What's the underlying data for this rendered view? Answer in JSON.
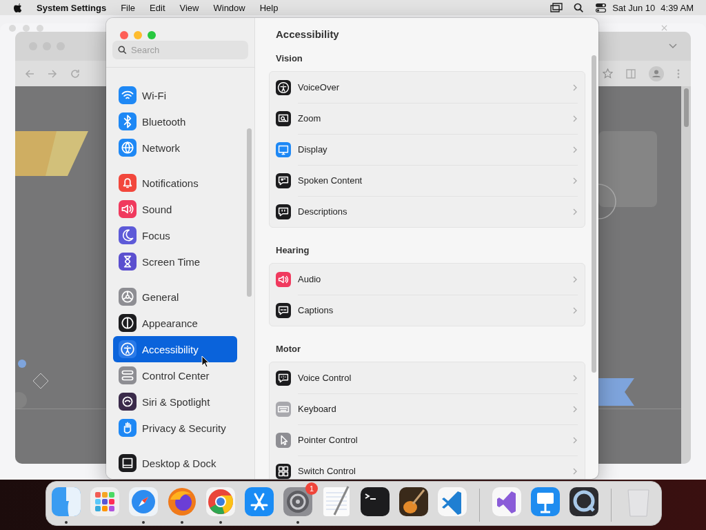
{
  "menu_bar": {
    "app_name": "System Settings",
    "menus": [
      "File",
      "Edit",
      "View",
      "Window",
      "Help"
    ],
    "date": "Sat Jun 10",
    "time": "4:39 AM"
  },
  "settings": {
    "title": "Accessibility",
    "search": {
      "placeholder": "Search"
    },
    "sidebar": [
      {
        "items": [
          {
            "label": "Wi-Fi",
            "color": "#1e88f5",
            "selected": false
          },
          {
            "label": "Bluetooth",
            "color": "#1e88f5",
            "selected": false
          },
          {
            "label": "Network",
            "color": "#1e88f5",
            "selected": false
          }
        ]
      },
      {
        "items": [
          {
            "label": "Notifications",
            "color": "#f2473c",
            "selected": false
          },
          {
            "label": "Sound",
            "color": "#f03a5e",
            "selected": false
          },
          {
            "label": "Focus",
            "color": "#5d5ad8",
            "selected": false
          },
          {
            "label": "Screen Time",
            "color": "#5b4fcf",
            "selected": false
          }
        ]
      },
      {
        "items": [
          {
            "label": "General",
            "color": "#8e8e93",
            "selected": false
          },
          {
            "label": "Appearance",
            "color": "#1c1c1e",
            "selected": false
          },
          {
            "label": "Accessibility",
            "color": "#2a7ae8",
            "selected": true
          },
          {
            "label": "Control Center",
            "color": "#8e8e93",
            "selected": false
          },
          {
            "label": "Siri & Spotlight",
            "color": "#3a2a4a",
            "selected": false
          },
          {
            "label": "Privacy & Security",
            "color": "#1e88f5",
            "selected": false
          }
        ]
      },
      {
        "items": [
          {
            "label": "Desktop & Dock",
            "color": "#1c1c1e",
            "selected": false
          }
        ]
      }
    ],
    "sections": [
      {
        "heading": "Vision",
        "rows": [
          {
            "label": "VoiceOver",
            "color": "#1c1c1e"
          },
          {
            "label": "Zoom",
            "color": "#1c1c1e"
          },
          {
            "label": "Display",
            "color": "#1e88f5"
          },
          {
            "label": "Spoken Content",
            "color": "#1c1c1e"
          },
          {
            "label": "Descriptions",
            "color": "#1c1c1e"
          }
        ]
      },
      {
        "heading": "Hearing",
        "rows": [
          {
            "label": "Audio",
            "color": "#f03a5e"
          },
          {
            "label": "Captions",
            "color": "#1c1c1e"
          }
        ]
      },
      {
        "heading": "Motor",
        "rows": [
          {
            "label": "Voice Control",
            "color": "#1c1c1e"
          },
          {
            "label": "Keyboard",
            "color": "#a8a8ad"
          },
          {
            "label": "Pointer Control",
            "color": "#8e8e93"
          },
          {
            "label": "Switch Control",
            "color": "#1c1c1e"
          }
        ]
      }
    ]
  },
  "dock": {
    "items": [
      {
        "kind": "app",
        "running": true
      },
      {
        "kind": "app",
        "running": false
      },
      {
        "kind": "app",
        "running": true
      },
      {
        "kind": "app",
        "running": true
      },
      {
        "kind": "app",
        "running": true
      },
      {
        "kind": "app",
        "running": false
      },
      {
        "kind": "app",
        "running": true,
        "badge": "1"
      },
      {
        "kind": "app",
        "running": false
      },
      {
        "kind": "app",
        "running": false
      },
      {
        "kind": "app",
        "running": false
      },
      {
        "kind": "app",
        "running": false
      },
      {
        "kind": "separator"
      },
      {
        "kind": "app",
        "running": false
      },
      {
        "kind": "app",
        "running": false
      },
      {
        "kind": "app",
        "running": false
      },
      {
        "kind": "separator"
      },
      {
        "kind": "app",
        "running": false
      }
    ]
  }
}
